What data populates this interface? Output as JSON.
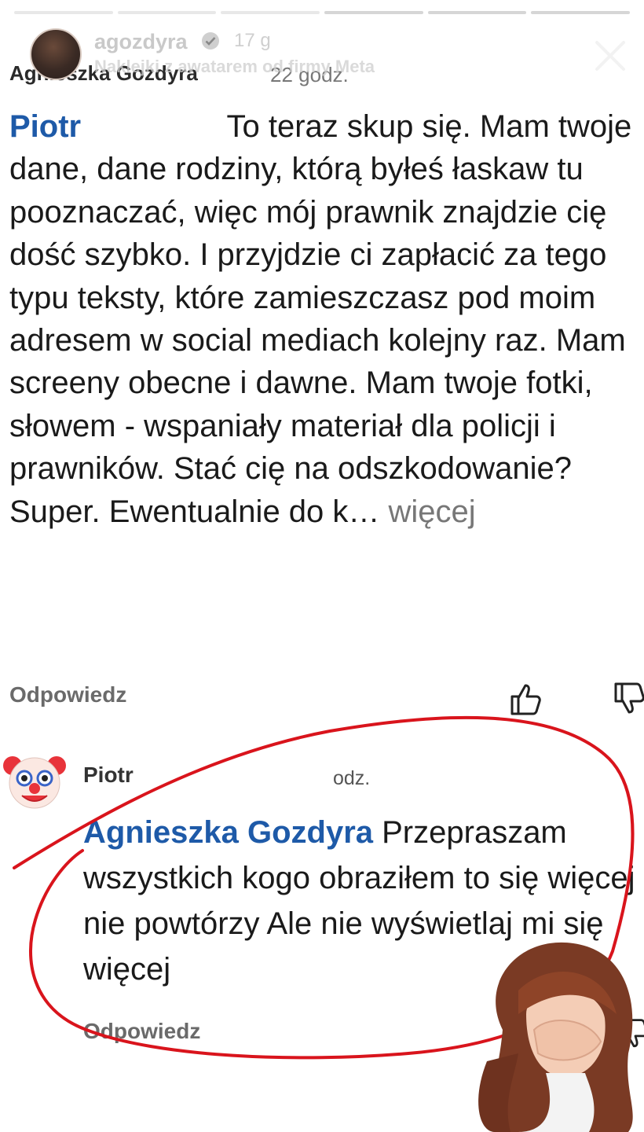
{
  "story": {
    "username": "agozdyra",
    "time": "17 g",
    "meta_label": "Naklejki z awatarem od firmy Meta",
    "progress": [
      1,
      1,
      1,
      0,
      0,
      0
    ]
  },
  "comment1": {
    "author": "Agnieszka Gozdyra",
    "time": "22 godz.",
    "mention": "Piotr",
    "text": " To teraz skup się. Mam twoje dane, dane rodziny, którą byłeś łaskaw tu pooznaczać, więc mój prawnik znajdzie cię dość szybko. I przyjdzie ci zapłacić za tego typu teksty, które zamieszczasz pod moim adresem w social mediach kolejny raz. Mam screeny obecne i dawne. Mam twoje fotki, słowem - wspaniały materiał dla policji i prawników. Stać cię na odszkodowanie? Super. Ewentualnie do k… ",
    "more": "więcej",
    "reply_label": "Odpowiedz"
  },
  "comment2": {
    "author": "Piotr",
    "time": "odz.",
    "mention": "Agnieszka Gozdyra",
    "text": " Przepraszam wszystkich kogo obraziłem to się więcej nie powtórzy Ale nie wyświetlaj mi się  więcej",
    "reply_label": "Odpowiedz"
  },
  "colors": {
    "mention": "#1e5aa8",
    "annotation": "#d9141c"
  }
}
